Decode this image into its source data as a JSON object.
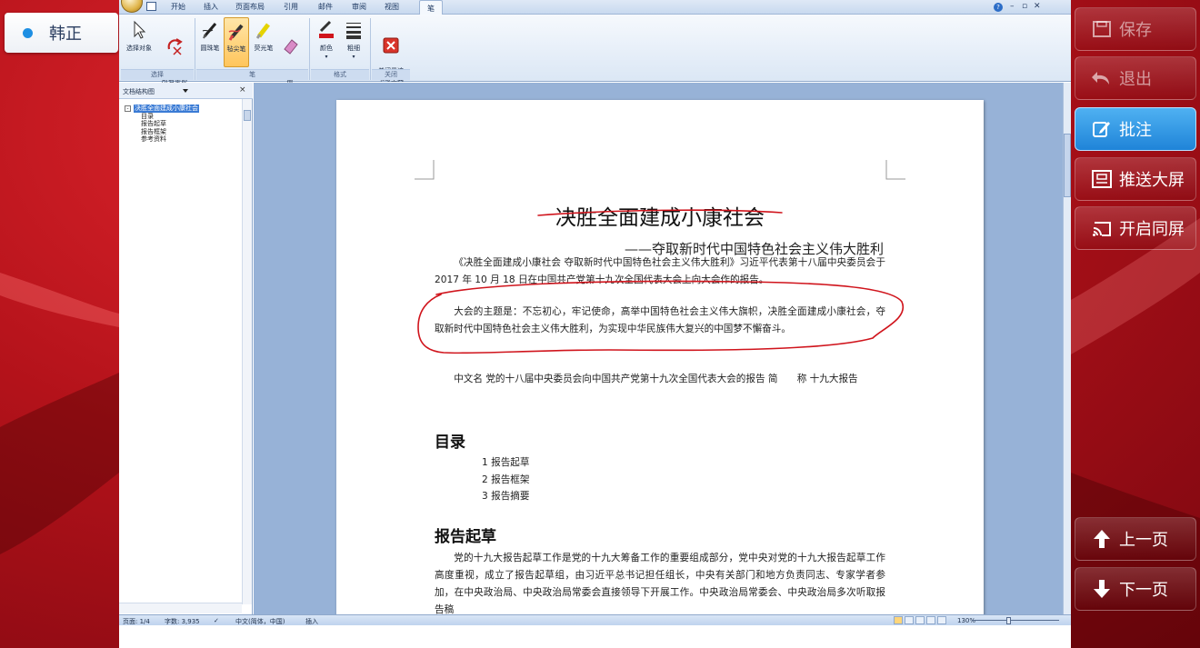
{
  "presenter": {
    "name": "韩正"
  },
  "side_buttons": {
    "save": "保存",
    "exit": "退出",
    "annotate": "批注",
    "push_screen": "推送大屏",
    "sync_screen": "开启同屏",
    "prev_page": "上一页",
    "next_page": "下一页"
  },
  "ribbon_tabs": [
    "开始",
    "插入",
    "页面布局",
    "引用",
    "邮件",
    "审阅",
    "视图",
    "笔"
  ],
  "ribbon": {
    "select_object": "选择对象",
    "delete_all_ink": "删除\n所有墨迹",
    "ballpoint_pen": "圆珠笔",
    "felt_tip_pen": "毡尖笔",
    "highlighter": "荧光笔",
    "eraser": "橡皮\n擦",
    "color": "颜色",
    "thickness": "粗细",
    "close_ink_tools": "关闭墨迹\n书写工具",
    "group_select": "选择",
    "group_pen": "笔",
    "group_format": "格式",
    "group_close": "关闭"
  },
  "nav": {
    "title": "文档结构图",
    "close": "×",
    "root": "决胜全面建成小康社会",
    "children": [
      "目录",
      "报告起草",
      "报告框架",
      "参考资料"
    ]
  },
  "document": {
    "title": "决胜全面建成小康社会",
    "subtitle": "——夺取新时代中国特色社会主义伟大胜利",
    "p1": "《决胜全面建成小康社会 夺取新时代中国特色社会主义伟大胜利》习近平代表第十八届中央委员会于 2017 年 10 月 18 日在中国共产党第十九次全国代表大会上向大会作的报告。",
    "p2": "大会的主题是：不忘初心，牢记使命，高举中国特色社会主义伟大旗帜，决胜全面建成小康社会，夺取新时代中国特色社会主义伟大胜利，为实现中华民族伟大复兴的中国梦不懈奋斗。",
    "p3": "中文名 党的十八届中央委员会向中国共产党第十九次全国代表大会的报告 简　　称 十九大报告",
    "toc_heading": "目录",
    "toc": [
      "1 报告起草",
      "2 报告框架",
      "3 报告摘要"
    ],
    "section1_heading": "报告起草",
    "section1_text": "党的十九大报告起草工作是党的十九大筹备工作的重要组成部分，党中央对党的十九大报告起草工作高度重视，成立了报告起草组，由习近平总书记担任组长，中央有关部门和地方负责同志、专家学者参加，在中央政治局、中央政治局常委会直接领导下开展工作。中央政治局常委会、中央政治局多次听取报告稿"
  },
  "status_bar": {
    "page": "页面: 1/4",
    "words": "字数: 3,935",
    "language": "中文(简体，中国)",
    "insert_mode": "插入",
    "zoom": "130%"
  },
  "colors": {
    "annotation_red": "#d0141c",
    "active_button": "#2a8fe0"
  }
}
